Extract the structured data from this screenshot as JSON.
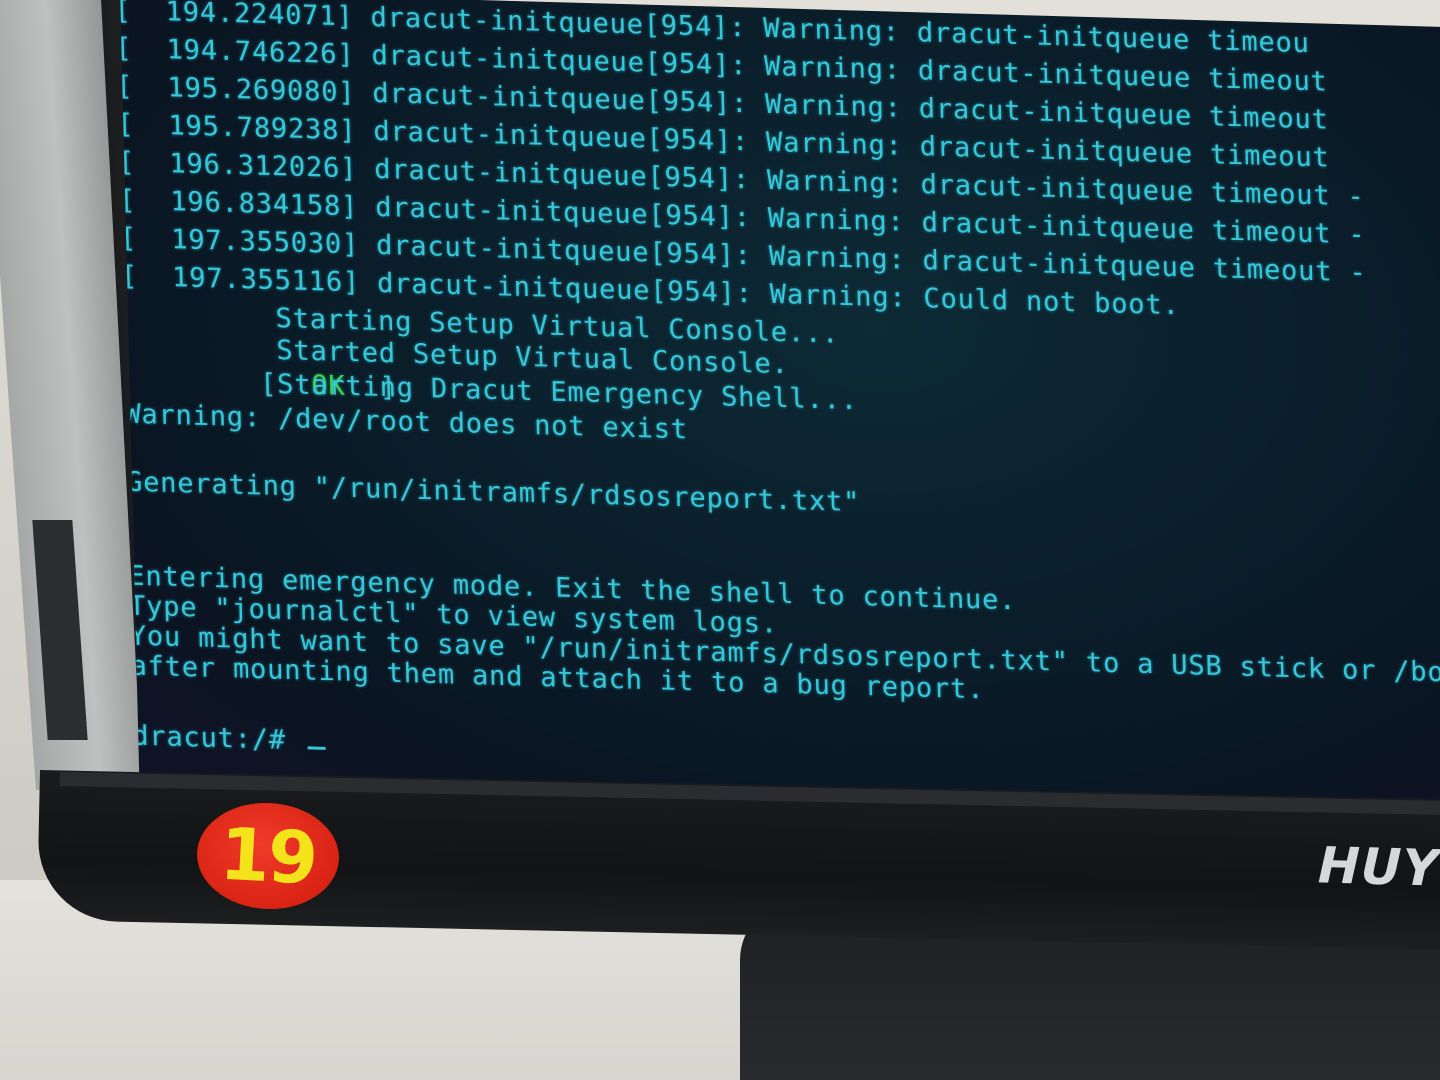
{
  "terminal": {
    "lines": [
      "[  194.224071] dracut-initqueue[954]: Warning: dracut-initqueue timeou",
      "[  194.746226] dracut-initqueue[954]: Warning: dracut-initqueue timeout",
      "[  195.269080] dracut-initqueue[954]: Warning: dracut-initqueue timeout",
      "[  195.789238] dracut-initqueue[954]: Warning: dracut-initqueue timeout",
      "[  196.312026] dracut-initqueue[954]: Warning: dracut-initqueue timeout -",
      "[  196.834158] dracut-initqueue[954]: Warning: dracut-initqueue timeout -",
      "[  197.355030] dracut-initqueue[954]: Warning: dracut-initqueue timeout -",
      "[  197.355116] dracut-initqueue[954]: Warning: Could not boot.",
      "         Starting Setup Virtual Console...",
      "         Started Setup Virtual Console.",
      "         Starting Dracut Emergency Shell...",
      "Warning: /dev/root does not exist",
      "",
      "Generating \"/run/initramfs/rdsosreport.txt\"",
      "",
      "",
      "Entering emergency mode. Exit the shell to continue.",
      "Type \"journalctl\" to view system logs.",
      "You might want to save \"/run/initramfs/rdsosreport.txt\" to a USB stick or /boot",
      "after mounting them and attach it to a bug report.",
      "",
      "",
      "dracut:/# "
    ],
    "ok_status": "OK",
    "ok_open": "[",
    "ok_close": "]",
    "text_color": "#35c8da",
    "ok_color": "#3ad35a"
  },
  "sticker": {
    "number": "19",
    "color": "#d92414",
    "text_color": "#f4e21a"
  },
  "brand": {
    "label": "HUY"
  }
}
